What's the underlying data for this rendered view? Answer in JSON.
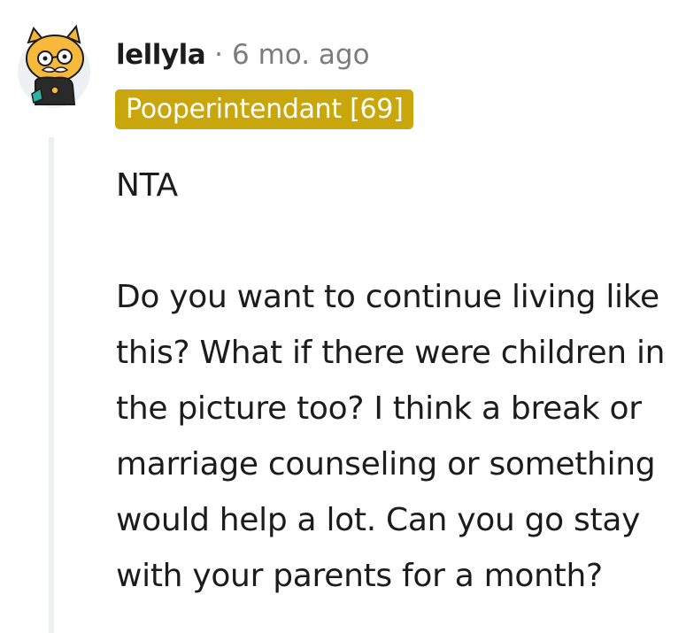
{
  "comment": {
    "author": "lellyla",
    "separator": "·",
    "timestamp": "6 mo. ago",
    "flair": "Pooperintendant [69]",
    "flair_color": "#c8a60c",
    "avatar_icon": "snoo-avatar-icon",
    "body": [
      "NTA",
      "Do you want to continue living like this? What if there were children in the picture too? I think a break or marriage counseling or something would help a lot. Can you go stay with your parents for a month?"
    ]
  }
}
